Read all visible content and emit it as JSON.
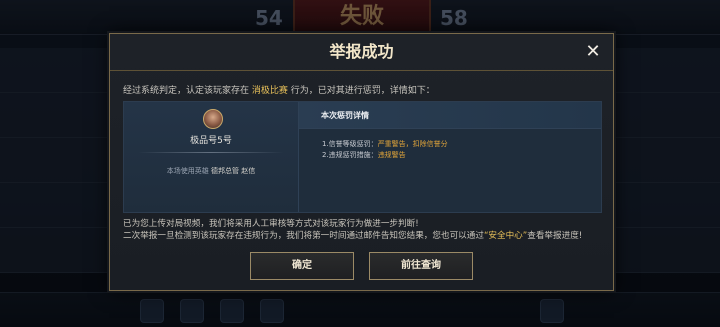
{
  "background": {
    "banner_text": "失败",
    "score_left": "54",
    "score_right": "58"
  },
  "dialog": {
    "title": "举报成功",
    "close_icon": "close-icon",
    "intro": {
      "prefix": "经过系统判定，认定该玩家存在",
      "highlight": "消极比赛",
      "suffix": "行为，已对其进行惩罚，详情如下："
    },
    "player": {
      "name": "极品号5号",
      "hero_prefix": "本场使用英雄",
      "hero_name": "德邦总管 赵信"
    },
    "penalty": {
      "title": "本次惩罚详情",
      "line1_prefix": "1.信誉等级惩罚：",
      "line1_value": "严重警告，扣除信誉分",
      "line2_prefix": "2.违规惩罚措施：",
      "line2_value": "违规警告"
    },
    "notice": {
      "line1": "已为您上传对局视频，我们将采用人工审核等方式对该玩家行为做进一步判断!",
      "line2_prefix": "二次举报一旦检测到该玩家存在违规行为，我们将第一时间通过邮件告知您结果，您也可以通过",
      "line2_highlight": "“安全中心”",
      "line2_suffix": "查看举报进度!"
    },
    "buttons": {
      "confirm": "确定",
      "query": "前往查询"
    }
  },
  "colors": {
    "accent_gold": "#e8c15a",
    "border_gold": "#9b8a66",
    "panel_blue": "#1f2d3c",
    "penalty_orange": "#e2a53a"
  }
}
